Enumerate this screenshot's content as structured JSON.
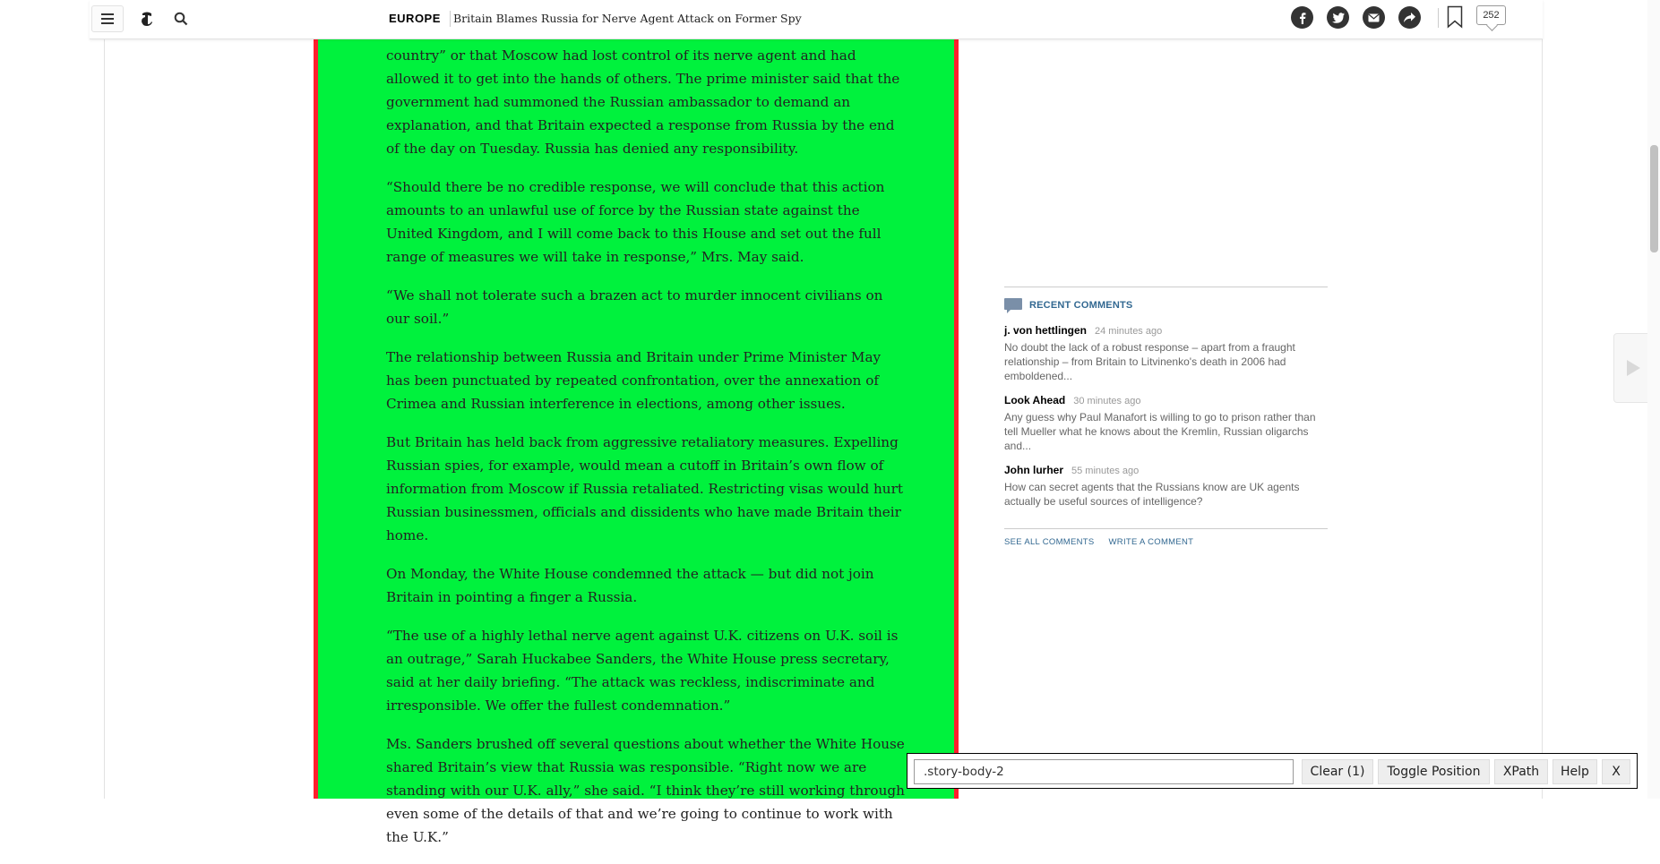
{
  "header": {
    "section": "EUROPE",
    "headline": "Britain Blames Russia for Nerve Agent Attack on Former Spy",
    "comment_count": "252",
    "icons": [
      "menu-icon",
      "nyt-logo-icon",
      "search-icon",
      "facebook-icon",
      "twitter-icon",
      "email-icon",
      "share-icon",
      "bookmark-icon",
      "comment-bubble-icon"
    ]
  },
  "story": {
    "paragraphs": [
      "country” or that Moscow had lost control of its nerve agent and had allowed it to get into the hands of others. The prime minister said that the government had summoned the Russian ambassador to demand an explanation, and that Britain expected a response from Russia by the end of the day on Tuesday. Russia has denied any responsibility.",
      "“Should there be no credible response, we will conclude that this action amounts to an unlawful use of force by the Russian state against the United Kingdom, and I will come back to this House and set out the full range of measures we will take in response,” Mrs. May said.",
      "“We shall not tolerate such a brazen act to murder innocent civilians on our soil.”",
      "The relationship between Russia and Britain under Prime Minister May has been punctuated by repeated confrontation, over the annexation of Crimea and Russian interference in elections, among other issues.",
      "But Britain has held back from aggressive retaliatory measures. Expelling Russian spies, for example, would mean a cutoff in Britain’s own flow of information from Moscow if Russia retaliated. Restricting visas would hurt Russian businessmen, officials and dissidents who have made Britain their home.",
      "On Monday, the White House condemned the attack — but did not join Britain in pointing a finger a Russia.",
      "“The use of a highly lethal nerve agent against U.K. citizens on U.K. soil is an outrage,” Sarah Huckabee Sanders, the White House press secretary, said at her daily briefing. “The attack was reckless, indiscriminate and irresponsible. We offer the fullest condemnation.”",
      "Ms. Sanders brushed off several questions about whether the White House shared Britain’s view that Russia was responsible. “Right now we are standing with our U.K. ally,” she said. “I think they’re still working through even some of the details of that and we’re going to continue to work with the U.K.”"
    ]
  },
  "recent_comments": {
    "title": "RECENT COMMENTS",
    "items": [
      {
        "author": "j. von hettlingen",
        "time": "24 minutes ago",
        "text": "No doubt the lack of a robust response – apart from a fraught relationship – from Britain to Litvinenko's death in 2006 had emboldened..."
      },
      {
        "author": "Look Ahead",
        "time": "30 minutes ago",
        "text": "Any guess why Paul Manafort is willing to go to prison rather than tell Mueller what he knows about the Kremlin, Russian oligarchs and..."
      },
      {
        "author": "John lurher",
        "time": "55 minutes ago",
        "text": "How can secret agents that the Russians know are UK agents actually be useful sources of intelligence?"
      }
    ],
    "see_all": "SEE ALL COMMENTS",
    "write": "WRITE A COMMENT"
  },
  "selector_tool": {
    "query": ".story-body-2",
    "clear_label": "Clear (1)",
    "toggle_label": "Toggle Position",
    "xpath_label": "XPath",
    "help_label": "Help",
    "close_label": "X"
  },
  "colors": {
    "highlight_fill": "#00f23d",
    "highlight_border": "#ff1f2d",
    "link_blue": "#326891"
  }
}
